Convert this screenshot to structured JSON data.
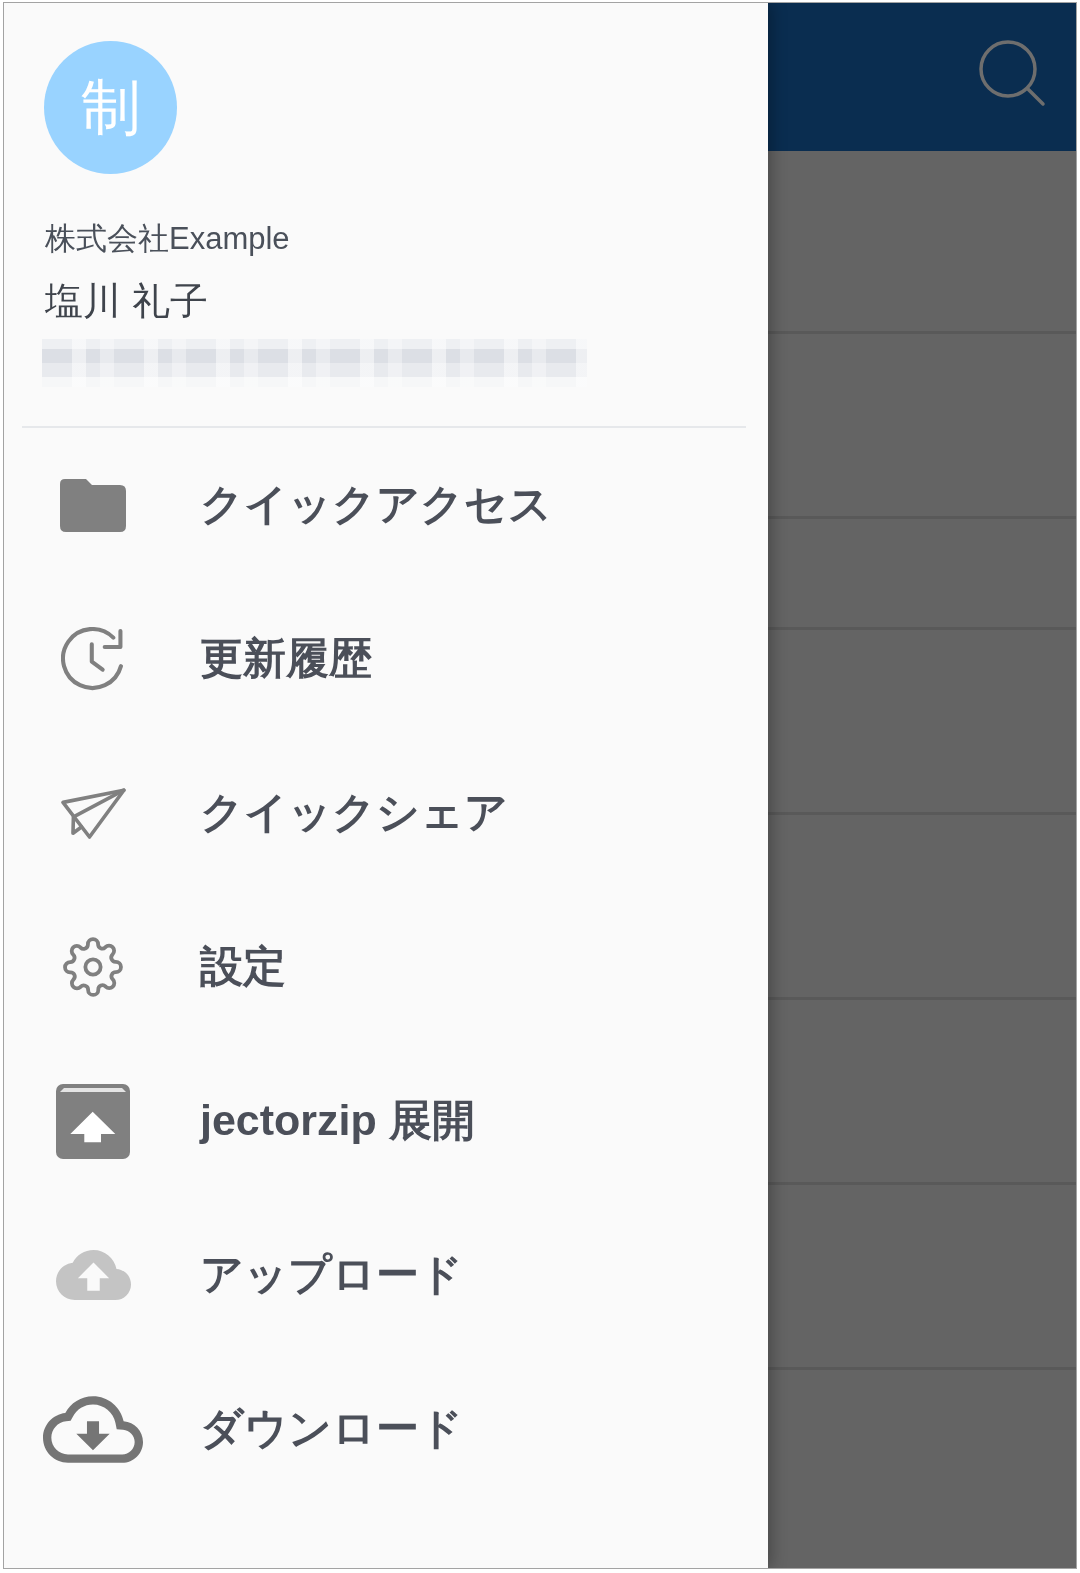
{
  "drawer": {
    "avatar": {
      "initial": "制"
    },
    "company": "株式会社Example",
    "user_name": "塩川 礼子",
    "menu": [
      {
        "kind": "folder",
        "label": "クイックアクセス"
      },
      {
        "kind": "history",
        "label": "更新履歴"
      },
      {
        "kind": "send",
        "label": "クイックシェア"
      },
      {
        "kind": "settings",
        "label": "設定"
      },
      {
        "kind": "archive",
        "label": "jectorzip 展開"
      },
      {
        "kind": "cloud-upload",
        "label": "アップロード"
      },
      {
        "kind": "cloud-download",
        "label": "ダウンロード"
      }
    ]
  }
}
